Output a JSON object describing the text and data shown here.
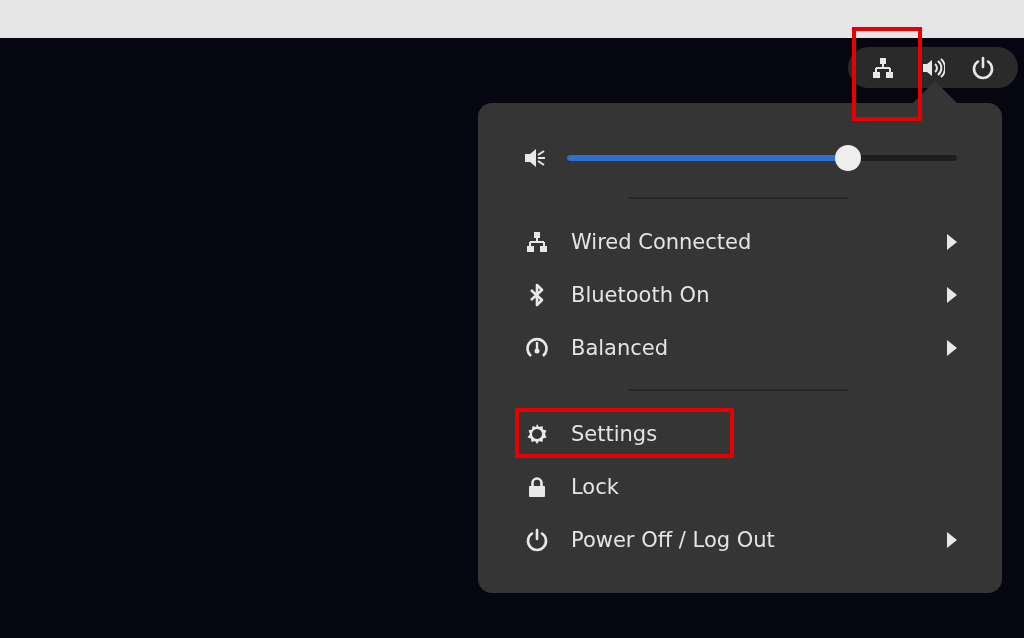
{
  "status_icons": [
    {
      "kind": "network",
      "annotated": true
    },
    {
      "kind": "sound",
      "annotated": false
    },
    {
      "kind": "power",
      "annotated": false
    }
  ],
  "volume": {
    "level": 0.72
  },
  "menu_groups": [
    [
      {
        "kind": "network",
        "label": "Wired Connected",
        "submenu": true,
        "annotated": false
      },
      {
        "kind": "bluetooth",
        "label": "Bluetooth On",
        "submenu": true,
        "annotated": false
      },
      {
        "kind": "power-mode",
        "label": "Balanced",
        "submenu": true,
        "annotated": false
      }
    ],
    [
      {
        "kind": "settings",
        "label": "Settings",
        "submenu": false,
        "annotated": true
      },
      {
        "kind": "lock",
        "label": "Lock",
        "submenu": false,
        "annotated": false
      },
      {
        "kind": "power",
        "label": "Power Off / Log Out",
        "submenu": true,
        "annotated": false
      }
    ]
  ]
}
